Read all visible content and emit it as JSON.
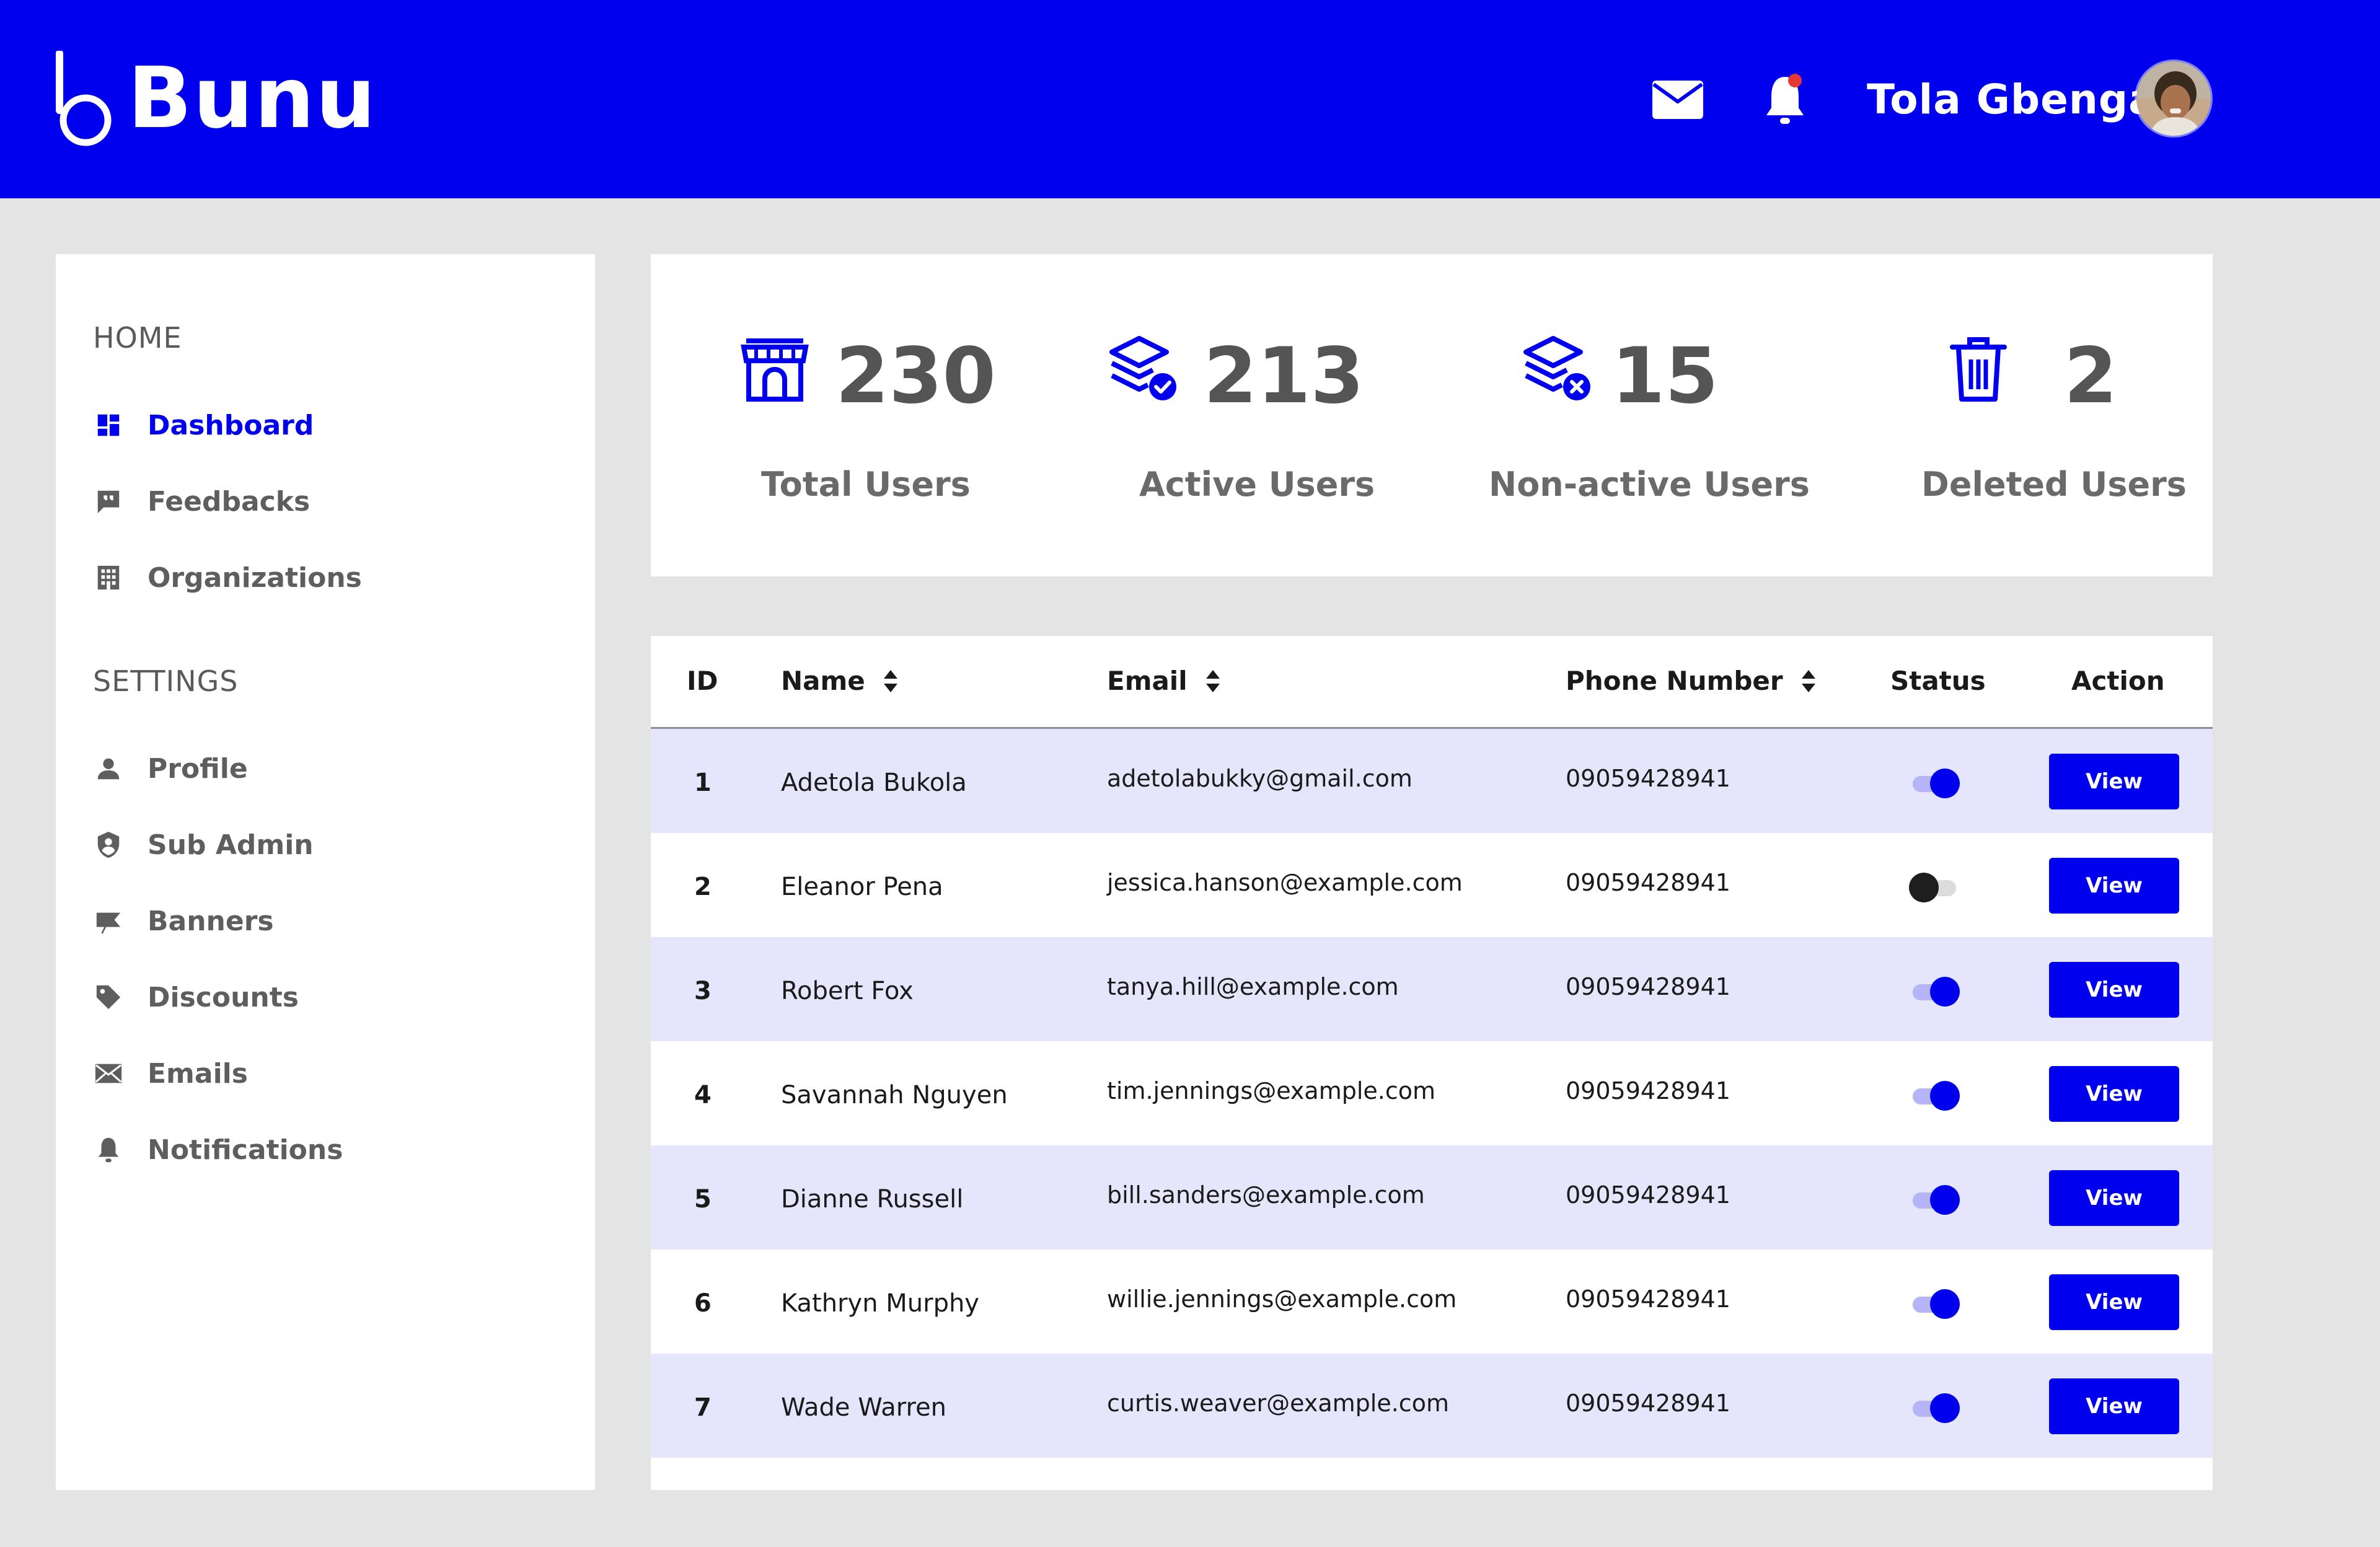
{
  "header": {
    "brand": "Bunu",
    "user_name": "Tola Gbenga",
    "icons": [
      "envelope-icon",
      "bell-icon"
    ],
    "notification_dot_color": "#E53935"
  },
  "colors": {
    "primary": "#0000EE",
    "row_alt": "#E5E5FC",
    "background": "#E4E4E4"
  },
  "sidebar": {
    "home_title": "HOME",
    "settings_title": "SETTINGS",
    "home_items": [
      {
        "label": "Dashboard",
        "icon": "dashboard-icon",
        "active": true
      },
      {
        "label": "Feedbacks",
        "icon": "feedback-icon"
      },
      {
        "label": "Organizations",
        "icon": "building-icon"
      }
    ],
    "settings_items": [
      {
        "label": "Profile",
        "icon": "person-icon"
      },
      {
        "label": "Sub Admin",
        "icon": "shield-user-icon"
      },
      {
        "label": "Banners",
        "icon": "flag-icon"
      },
      {
        "label": "Discounts",
        "icon": "tag-icon"
      },
      {
        "label": "Emails",
        "icon": "mail-icon"
      },
      {
        "label": "Notifications",
        "icon": "bell-icon"
      }
    ]
  },
  "stats": [
    {
      "value": "230",
      "label": "Total Users",
      "icon": "store-icon"
    },
    {
      "value": "213",
      "label": "Active Users",
      "icon": "layers-check-icon"
    },
    {
      "value": "15",
      "label": "Non-active Users",
      "icon": "layers-x-icon"
    },
    {
      "value": "2",
      "label": "Deleted Users",
      "icon": "trash-icon"
    }
  ],
  "table": {
    "columns": {
      "id": "ID",
      "name": "Name",
      "email": "Email",
      "phone": "Phone Number",
      "status": "Status",
      "action": "Action"
    },
    "rows": [
      {
        "id": "1",
        "name": "Adetola Bukola",
        "email": "adetolabukky@gmail.com",
        "phone": "09059428941",
        "active": true,
        "action": "View"
      },
      {
        "id": "2",
        "name": "Eleanor Pena",
        "email": "jessica.hanson@example.com",
        "phone": "09059428941",
        "active": false,
        "action": "View"
      },
      {
        "id": "3",
        "name": "Robert Fox",
        "email": "tanya.hill@example.com",
        "phone": "09059428941",
        "active": true,
        "action": "View"
      },
      {
        "id": "4",
        "name": "Savannah Nguyen",
        "email": "tim.jennings@example.com",
        "phone": "09059428941",
        "active": true,
        "action": "View"
      },
      {
        "id": "5",
        "name": "Dianne Russell",
        "email": "bill.sanders@example.com",
        "phone": "09059428941",
        "active": true,
        "action": "View"
      },
      {
        "id": "6",
        "name": "Kathryn Murphy",
        "email": "willie.jennings@example.com",
        "phone": "09059428941",
        "active": true,
        "action": "View"
      },
      {
        "id": "7",
        "name": "Wade Warren",
        "email": "curtis.weaver@example.com",
        "phone": "09059428941",
        "active": true,
        "action": "View"
      }
    ]
  }
}
